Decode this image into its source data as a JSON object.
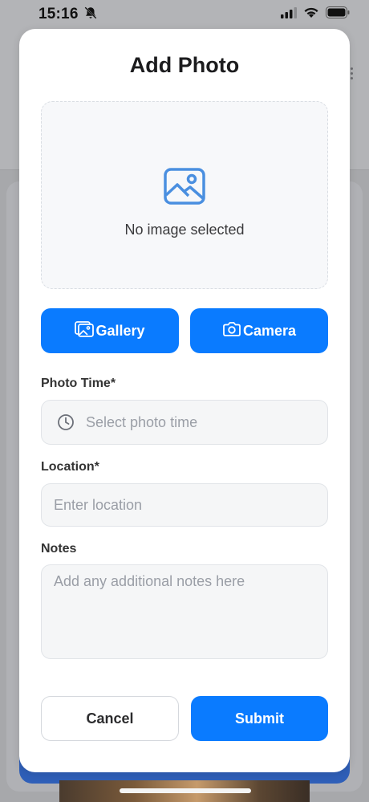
{
  "status_bar": {
    "time": "15:16",
    "icons": [
      "bell-slash-icon",
      "signal-icon",
      "wifi-icon",
      "battery-icon"
    ]
  },
  "sheet": {
    "title": "Add Photo",
    "image_placeholder": {
      "icon": "image-icon",
      "caption": "No image selected"
    },
    "buttons": {
      "gallery": {
        "label": "Gallery",
        "icon": "gallery-icon"
      },
      "camera": {
        "label": "Camera",
        "icon": "camera-icon"
      },
      "cancel": {
        "label": "Cancel"
      },
      "submit": {
        "label": "Submit"
      }
    },
    "fields": {
      "photo_time": {
        "label": "Photo Time*",
        "placeholder": "Select photo time",
        "icon": "clock-icon"
      },
      "location": {
        "label": "Location*",
        "placeholder": "Enter location"
      },
      "notes": {
        "label": "Notes",
        "placeholder": "Add any additional notes here"
      }
    }
  },
  "colors": {
    "accent": "#0a7bff",
    "sheet_background": "#ffffff",
    "field_background": "#f5f6f7",
    "overlay": "#a7a8ab"
  }
}
